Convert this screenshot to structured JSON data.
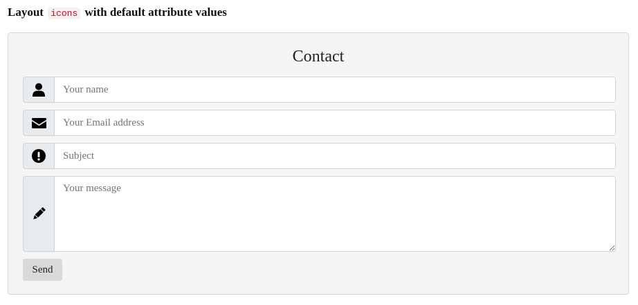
{
  "heading": {
    "before": "Layout",
    "code": "icons",
    "after": "with default attribute values"
  },
  "form": {
    "title": "Contact",
    "fields": {
      "name": {
        "placeholder": "Your name",
        "icon": "user-icon"
      },
      "email": {
        "placeholder": "Your Email address",
        "icon": "envelope-icon"
      },
      "subject": {
        "placeholder": "Subject",
        "icon": "exclamation-circle-icon"
      },
      "message": {
        "placeholder": "Your message",
        "icon": "pencil-icon"
      }
    },
    "send_label": "Send"
  },
  "colors": {
    "code_text": "#e0001b",
    "panel_bg": "#f5f5f5",
    "addon_bg": "#e9ecef"
  }
}
